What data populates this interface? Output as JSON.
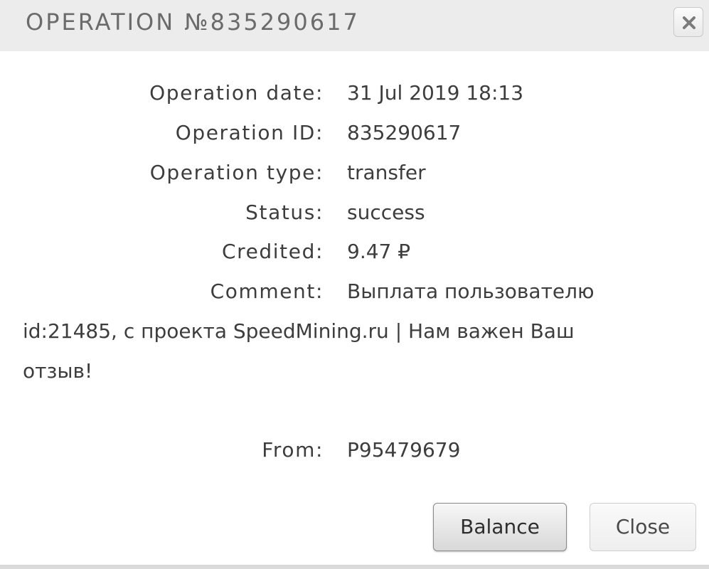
{
  "dialog": {
    "title": "OPERATION №835290617"
  },
  "fields": {
    "operation_date": {
      "label": "Operation date:",
      "value": "31 Jul 2019 18:13"
    },
    "operation_id": {
      "label": "Operation ID:",
      "value": "835290617"
    },
    "operation_type": {
      "label": "Operation type:",
      "value": "transfer"
    },
    "status": {
      "label": "Status:",
      "value": "success"
    },
    "credited": {
      "label": "Credited:",
      "value": "9.47 ₽"
    },
    "comment": {
      "label": "Comment:",
      "value_line1": "Выплата пользователю",
      "value_line2": "id:21485, с проекта SpeedMining.ru | Нам важен Ваш",
      "value_line3": "отзыв!"
    },
    "from": {
      "label": "From:",
      "value": "P95479679"
    }
  },
  "buttons": {
    "balance_label": "Balance",
    "close_label": "Close"
  },
  "icons": {
    "close": "close-icon"
  },
  "colors": {
    "titlebar_bg": "#ececec",
    "title_text": "#6b6b6b",
    "body_text": "#3d3d3d"
  }
}
